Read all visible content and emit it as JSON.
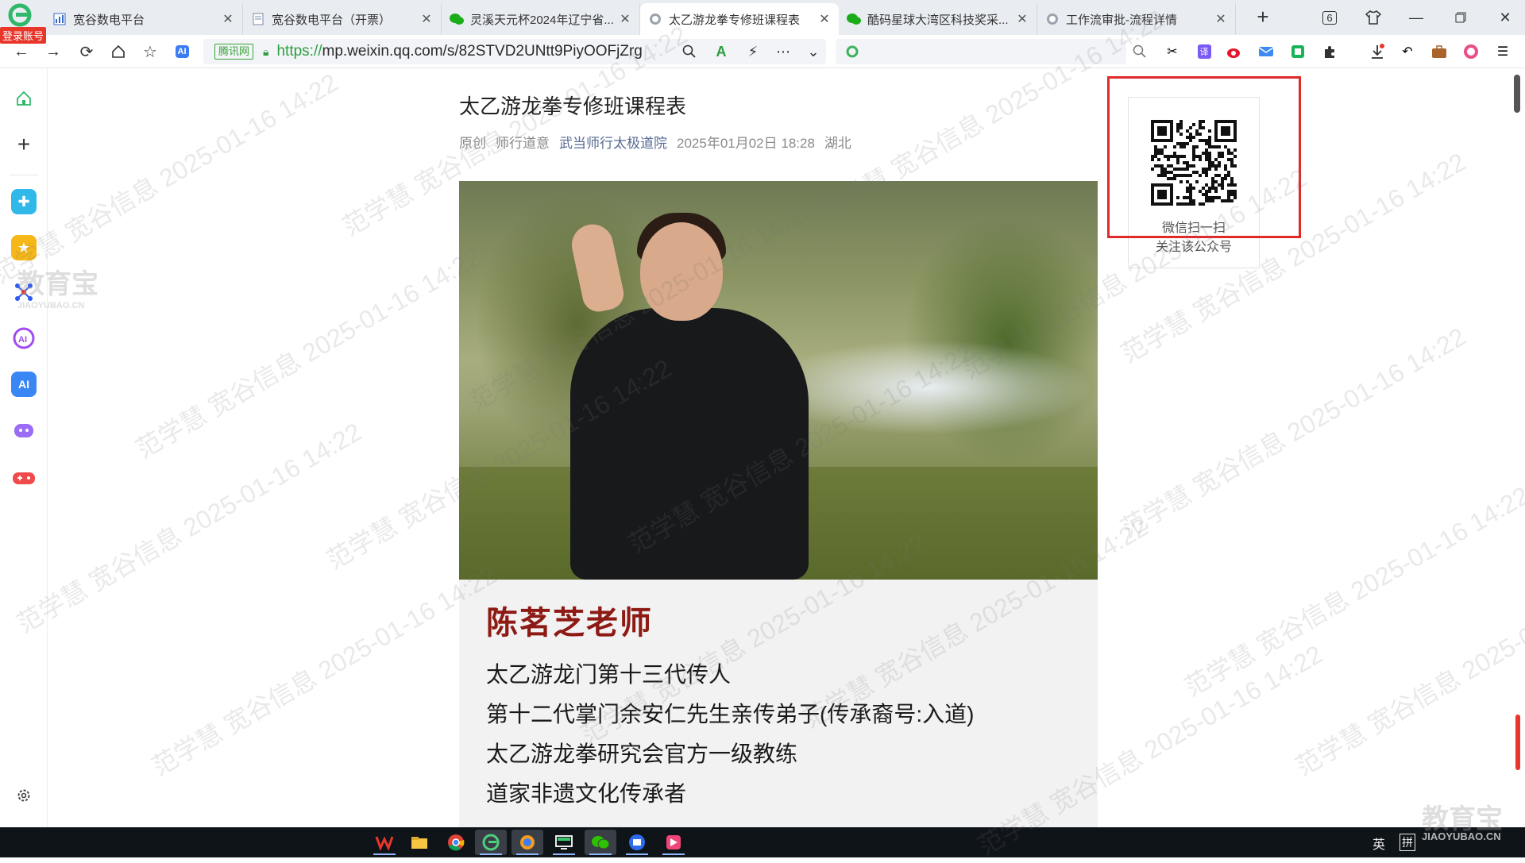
{
  "browser": {
    "login_badge": "登录账号",
    "tabs": [
      {
        "title": "宽谷数电平台",
        "active": false
      },
      {
        "title": "宽谷数电平台（开票）",
        "active": false
      },
      {
        "title": "灵溪天元杯2024年辽宁省...",
        "active": false
      },
      {
        "title": "太乙游龙拳专修班课程表",
        "active": true
      },
      {
        "title": "酷码星球大湾区科技奖采...",
        "active": false
      },
      {
        "title": "工作流审批-流程详情",
        "active": false
      }
    ],
    "tab_count": "6",
    "address": {
      "cert_label": "腾讯网",
      "url_proto": "https://",
      "url_rest": "mp.weixin.qq.com/s/82STVD2UNtt9PiyOOFjZrg"
    }
  },
  "article": {
    "title": "太乙游龙拳专修班课程表",
    "meta": {
      "original": "原创",
      "author": "师行道意",
      "account": "武当师行太极道院",
      "datetime": "2025年01月02日 18:28",
      "location": "湖北"
    },
    "teacher": {
      "name": "陈茗芝老师",
      "credentials": [
        "太乙游龙门第十三代传人",
        "第十二代掌门余安仁先生亲传弟子(传承裔号:入道)",
        "太乙游龙拳研究会官方一级教练",
        "道家非遗文化传承者"
      ]
    }
  },
  "qr": {
    "line1": "微信扫一扫",
    "line2": "关注该公众号"
  },
  "watermarks": {
    "name": "范学慧",
    "company": "宽谷信息",
    "date": "2025-01-16 14:22"
  },
  "brand_watermark": {
    "cn": "教育宝",
    "en": "JIAOYUBAO.CN"
  },
  "tray": {
    "ime_lang": "英",
    "ime_mode": "拼"
  },
  "colors": {
    "accent_green": "#2e9e3e",
    "teacher_red": "#8d1a14",
    "highlight_red": "#e02a2a",
    "account_blue": "#576b95"
  }
}
